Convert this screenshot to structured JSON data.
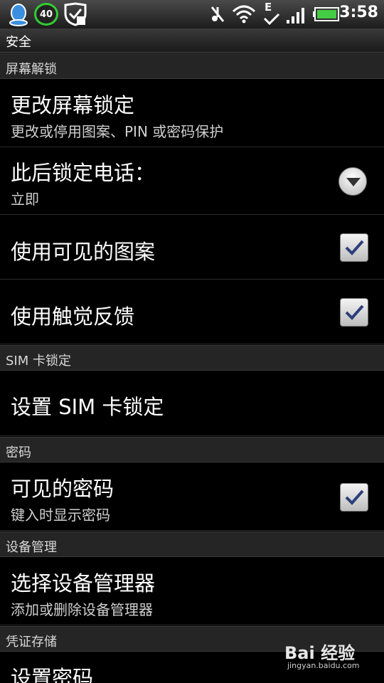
{
  "status_bar": {
    "badge_text": "40",
    "time": "3:58",
    "network_type": "E",
    "icons": [
      "qq-icon",
      "security-shield-icon",
      "mute-icon",
      "wifi-icon",
      "signal-icon",
      "battery-icon"
    ]
  },
  "title": "安全",
  "sections": {
    "screen_unlock": {
      "header": "屏幕解锁",
      "change_lock": {
        "title": "更改屏幕锁定",
        "summary": "更改或停用图案、PIN 或密码保护"
      },
      "lock_after": {
        "title": "此后锁定电话：",
        "summary": "立即"
      },
      "visible_pattern": {
        "title": "使用可见的图案",
        "checked": true
      },
      "haptic": {
        "title": "使用触觉反馈",
        "checked": true
      }
    },
    "sim_lock": {
      "header": "SIM 卡锁定",
      "set_sim": {
        "title": "设置 SIM 卡锁定"
      }
    },
    "passwords": {
      "header": "密码",
      "visible_passwords": {
        "title": "可见的密码",
        "summary": "键入时显示密码",
        "checked": true
      }
    },
    "device_admin": {
      "header": "设备管理",
      "select_admin": {
        "title": "选择设备管理器",
        "summary": "添加或删除设备管理器"
      }
    },
    "credential_storage": {
      "header": "凭证存储",
      "set_password": {
        "title": "设置密码"
      }
    }
  },
  "watermark": {
    "logo": "Bai 经验",
    "url": "jingyan.baidu.com"
  },
  "colors": {
    "checkmark": "#2b3f7a",
    "badge_ring": "#33cc33",
    "battery": "#44cc44"
  }
}
